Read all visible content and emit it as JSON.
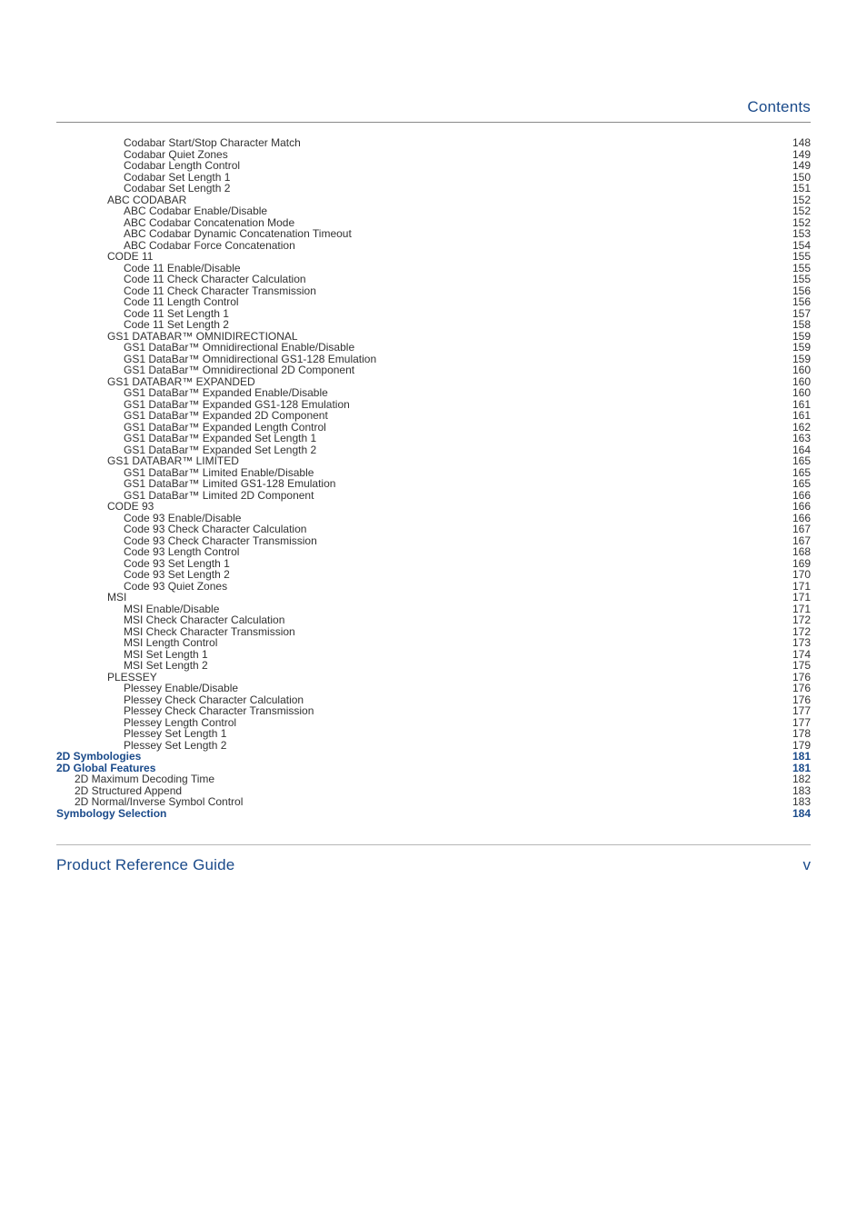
{
  "header": {
    "title": "Contents"
  },
  "footer": {
    "left": "Product Reference Guide",
    "right": "v"
  },
  "toc": [
    {
      "label": "Codabar Start/Stop Character Match",
      "page": "148",
      "level": 4,
      "blue": false,
      "bold": false
    },
    {
      "label": "Codabar Quiet Zones",
      "page": "149",
      "level": 4,
      "blue": false,
      "bold": false
    },
    {
      "label": "Codabar Length Control",
      "page": "149",
      "level": 4,
      "blue": false,
      "bold": false
    },
    {
      "label": "Codabar Set Length 1",
      "page": "150",
      "level": 4,
      "blue": false,
      "bold": false
    },
    {
      "label": "Codabar Set Length 2",
      "page": "151",
      "level": 4,
      "blue": false,
      "bold": false
    },
    {
      "label": "ABC CODABAR",
      "page": "152",
      "level": 3,
      "blue": false,
      "bold": false
    },
    {
      "label": "ABC Codabar Enable/Disable",
      "page": "152",
      "level": 4,
      "blue": false,
      "bold": false
    },
    {
      "label": "ABC Codabar Concatenation Mode",
      "page": "152",
      "level": 4,
      "blue": false,
      "bold": false
    },
    {
      "label": "ABC Codabar Dynamic Concatenation Timeout",
      "page": "153",
      "level": 4,
      "blue": false,
      "bold": false
    },
    {
      "label": "ABC Codabar Force Concatenation",
      "page": "154",
      "level": 4,
      "blue": false,
      "bold": false
    },
    {
      "label": "CODE 11",
      "page": "155",
      "level": 3,
      "blue": false,
      "bold": false
    },
    {
      "label": "Code 11 Enable/Disable",
      "page": "155",
      "level": 4,
      "blue": false,
      "bold": false
    },
    {
      "label": "Code 11 Check Character Calculation",
      "page": "155",
      "level": 4,
      "blue": false,
      "bold": false
    },
    {
      "label": "Code 11 Check Character Transmission",
      "page": "156",
      "level": 4,
      "blue": false,
      "bold": false
    },
    {
      "label": "Code 11 Length Control",
      "page": "156",
      "level": 4,
      "blue": false,
      "bold": false
    },
    {
      "label": "Code 11 Set Length 1",
      "page": "157",
      "level": 4,
      "blue": false,
      "bold": false
    },
    {
      "label": "Code 11 Set Length 2",
      "page": "158",
      "level": 4,
      "blue": false,
      "bold": false
    },
    {
      "label": "GS1 DATABAR™ OMNIDIRECTIONAL",
      "page": "159",
      "level": 3,
      "blue": false,
      "bold": false
    },
    {
      "label": "GS1 DataBar™ Omnidirectional Enable/Disable",
      "page": "159",
      "level": 4,
      "blue": false,
      "bold": false
    },
    {
      "label": "GS1 DataBar™ Omnidirectional GS1-128 Emulation",
      "page": "159",
      "level": 4,
      "blue": false,
      "bold": false
    },
    {
      "label": "GS1 DataBar™ Omnidirectional 2D Component",
      "page": "160",
      "level": 4,
      "blue": false,
      "bold": false
    },
    {
      "label": "GS1 DATABAR™ EXPANDED",
      "page": "160",
      "level": 3,
      "blue": false,
      "bold": false
    },
    {
      "label": "GS1 DataBar™ Expanded Enable/Disable",
      "page": "160",
      "level": 4,
      "blue": false,
      "bold": false
    },
    {
      "label": "GS1 DataBar™ Expanded GS1-128 Emulation",
      "page": "161",
      "level": 4,
      "blue": false,
      "bold": false
    },
    {
      "label": "GS1 DataBar™ Expanded 2D Component",
      "page": "161",
      "level": 4,
      "blue": false,
      "bold": false
    },
    {
      "label": "GS1 DataBar™ Expanded Length Control",
      "page": "162",
      "level": 4,
      "blue": false,
      "bold": false
    },
    {
      "label": "GS1 DataBar™ Expanded Set Length 1",
      "page": "163",
      "level": 4,
      "blue": false,
      "bold": false
    },
    {
      "label": "GS1 DataBar™ Expanded Set Length 2",
      "page": "164",
      "level": 4,
      "blue": false,
      "bold": false
    },
    {
      "label": "GS1 DATABAR™ LIMITED",
      "page": "165",
      "level": 3,
      "blue": false,
      "bold": false
    },
    {
      "label": "GS1 DataBar™ Limited Enable/Disable",
      "page": "165",
      "level": 4,
      "blue": false,
      "bold": false
    },
    {
      "label": "GS1 DataBar™ Limited GS1-128 Emulation",
      "page": "165",
      "level": 4,
      "blue": false,
      "bold": false
    },
    {
      "label": "GS1 DataBar™ Limited 2D Component",
      "page": "166",
      "level": 4,
      "blue": false,
      "bold": false
    },
    {
      "label": "CODE 93",
      "page": "166",
      "level": 3,
      "blue": false,
      "bold": false
    },
    {
      "label": "Code 93 Enable/Disable",
      "page": "166",
      "level": 4,
      "blue": false,
      "bold": false
    },
    {
      "label": "Code 93 Check Character Calculation",
      "page": "167",
      "level": 4,
      "blue": false,
      "bold": false
    },
    {
      "label": "Code 93 Check Character Transmission",
      "page": "167",
      "level": 4,
      "blue": false,
      "bold": false
    },
    {
      "label": "Code 93 Length Control",
      "page": "168",
      "level": 4,
      "blue": false,
      "bold": false
    },
    {
      "label": "Code 93 Set Length 1",
      "page": "169",
      "level": 4,
      "blue": false,
      "bold": false
    },
    {
      "label": "Code 93 Set Length 2",
      "page": "170",
      "level": 4,
      "blue": false,
      "bold": false
    },
    {
      "label": "Code 93 Quiet Zones",
      "page": "171",
      "level": 4,
      "blue": false,
      "bold": false
    },
    {
      "label": "MSI",
      "page": "171",
      "level": 3,
      "blue": false,
      "bold": false
    },
    {
      "label": "MSI Enable/Disable",
      "page": "171",
      "level": 4,
      "blue": false,
      "bold": false
    },
    {
      "label": "MSI Check Character Calculation",
      "page": "172",
      "level": 4,
      "blue": false,
      "bold": false
    },
    {
      "label": "MSI Check Character Transmission",
      "page": "172",
      "level": 4,
      "blue": false,
      "bold": false
    },
    {
      "label": "MSI Length Control",
      "page": "173",
      "level": 4,
      "blue": false,
      "bold": false
    },
    {
      "label": "MSI Set Length 1",
      "page": "174",
      "level": 4,
      "blue": false,
      "bold": false
    },
    {
      "label": "MSI Set Length 2",
      "page": "175",
      "level": 4,
      "blue": false,
      "bold": false
    },
    {
      "label": "PLESSEY",
      "page": "176",
      "level": 3,
      "blue": false,
      "bold": false
    },
    {
      "label": "Plessey Enable/Disable",
      "page": "176",
      "level": 4,
      "blue": false,
      "bold": false
    },
    {
      "label": "Plessey Check Character Calculation",
      "page": "176",
      "level": 4,
      "blue": false,
      "bold": false
    },
    {
      "label": "Plessey Check Character Transmission",
      "page": "177",
      "level": 4,
      "blue": false,
      "bold": false
    },
    {
      "label": "Plessey Length Control",
      "page": "177",
      "level": 4,
      "blue": false,
      "bold": false
    },
    {
      "label": "Plessey Set Length 1",
      "page": "178",
      "level": 4,
      "blue": false,
      "bold": false
    },
    {
      "label": "Plessey Set Length 2",
      "page": "179",
      "level": 4,
      "blue": false,
      "bold": false
    },
    {
      "label": "2D Symbologies",
      "page": " 181",
      "level": 0,
      "blue": true,
      "bold": true
    },
    {
      "label": "2D Global Features",
      "page": "181",
      "level": 0,
      "blue": true,
      "bold": true
    },
    {
      "label": "2D Maximum Decoding Time",
      "page": "182",
      "level": 1,
      "blue": false,
      "bold": false
    },
    {
      "label": "2D Structured Append",
      "page": "183",
      "level": 1,
      "blue": false,
      "bold": false
    },
    {
      "label": "2D Normal/Inverse Symbol Control",
      "page": "183",
      "level": 1,
      "blue": false,
      "bold": false
    },
    {
      "label": "Symbology Selection",
      "page": " 184",
      "level": 0,
      "blue": true,
      "bold": true
    }
  ]
}
